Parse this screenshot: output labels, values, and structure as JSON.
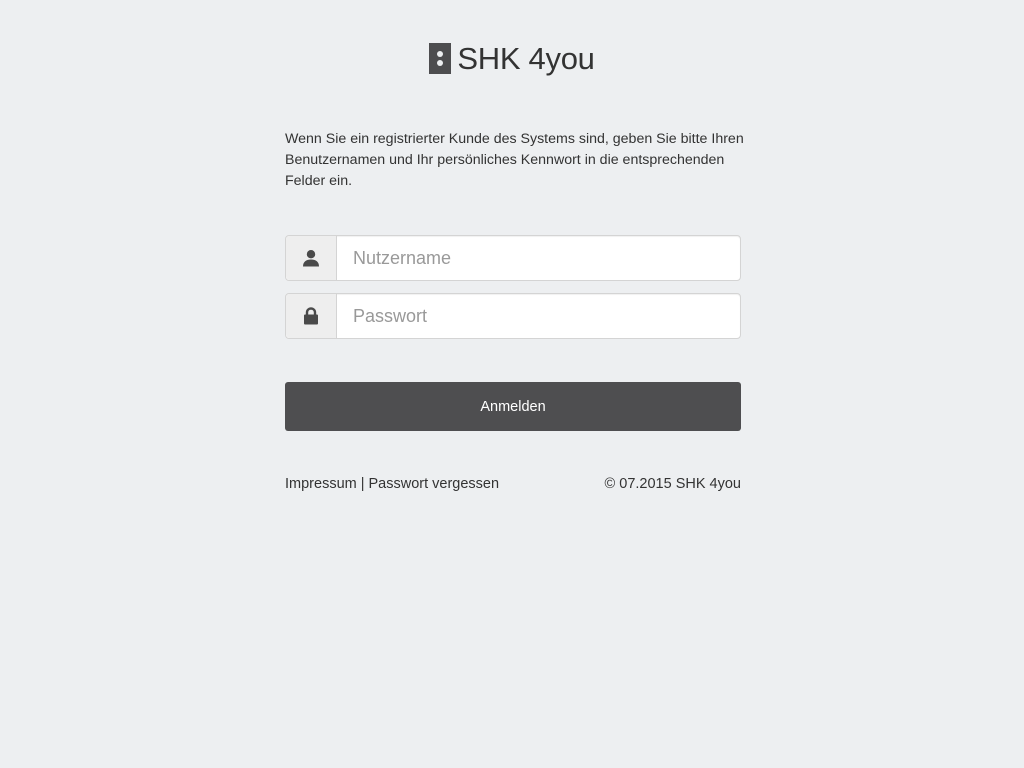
{
  "brand": {
    "name": "SHK 4you",
    "mark_color": "#4d4d4f"
  },
  "intro": {
    "text": "Wenn Sie ein registrierter Kunde des Systems sind, geben Sie bitte Ihren Benutzernamen und Ihr persönliches Kennwort in die entsprechenden Felder ein."
  },
  "form": {
    "username": {
      "placeholder": "Nutzername",
      "value": "",
      "icon": "user-icon"
    },
    "password": {
      "placeholder": "Passwort",
      "value": "",
      "icon": "lock-icon"
    },
    "submit_label": "Anmelden",
    "submit_color": "#4e4e50"
  },
  "footer": {
    "impressum_label": "Impressum",
    "separator": "|",
    "forgot_label": "Passwort vergessen",
    "copyright": "© 07.2015 SHK 4you"
  },
  "colors": {
    "background": "#edeff1",
    "text": "#333333"
  }
}
